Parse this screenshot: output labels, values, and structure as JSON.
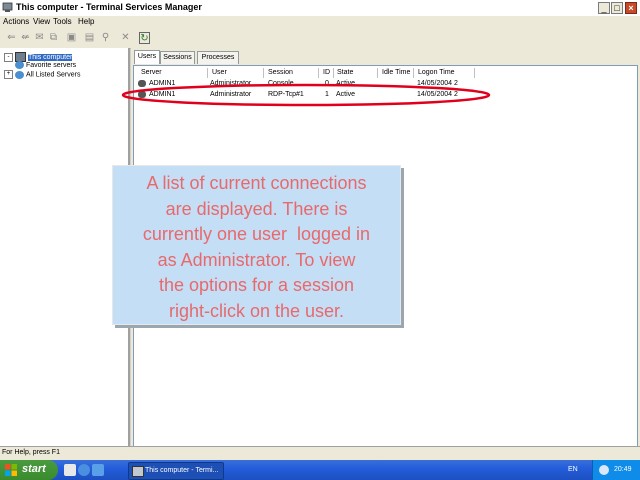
{
  "window": {
    "title": "This computer - Terminal Services Manager"
  },
  "menu": [
    "Actions",
    "View",
    "Tools",
    "Help"
  ],
  "tree": {
    "items": [
      {
        "label": "This computer",
        "selected": true
      },
      {
        "label": "Favorite servers",
        "selected": false
      },
      {
        "label": "All Listed Servers",
        "selected": false
      }
    ]
  },
  "tabs": [
    "Users",
    "Sessions",
    "Processes"
  ],
  "users_table": {
    "columns": [
      "Server",
      "User",
      "Session",
      "ID",
      "State",
      "Idle Time",
      "Logon Time"
    ],
    "rows": [
      [
        "ADMIN1",
        "Administrator",
        "Console",
        "0",
        "Active",
        "",
        "14/05/2004 2"
      ],
      [
        "ADMIN1",
        "Administrator",
        "RDP-Tcp#1",
        "1",
        "Active",
        "",
        "14/05/2004 2"
      ]
    ]
  },
  "callout": {
    "lines": [
      "A list of current connections",
      "are displayed. There is",
      "currently one user  logged in",
      "as Administrator. To view",
      "the options for a session",
      "right-click on the user."
    ]
  },
  "status_bar": {
    "text": "For Help, press F1"
  },
  "taskbar": {
    "start_label": "start",
    "task_label": "This computer - Termi...",
    "language": "EN",
    "clock": "20:49"
  },
  "colors": {
    "highlight_ellipse": "#e0001b",
    "callout_text": "#e8696c",
    "callout_bg": "#c4def6"
  }
}
